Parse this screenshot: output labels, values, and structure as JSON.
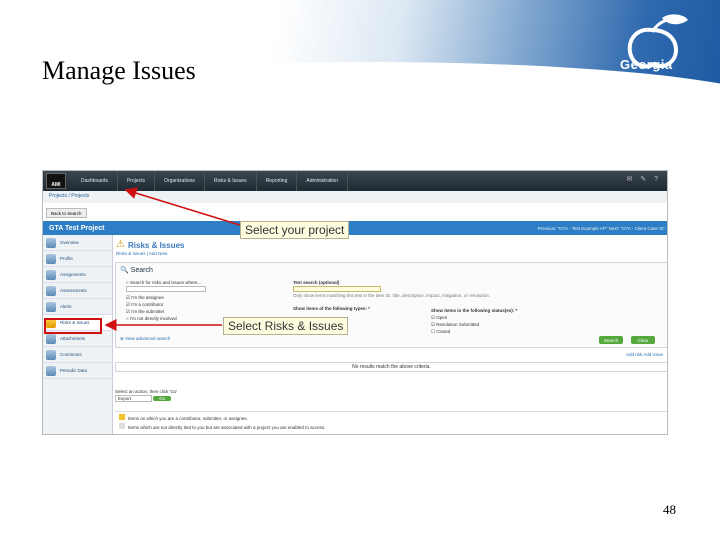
{
  "slide": {
    "title": "Manage Issues",
    "logo_text": "Georgia",
    "page_number": "48"
  },
  "app": {
    "logo": "AMI",
    "nav_tabs": [
      "Dashboards",
      "Projects",
      "Organizations",
      "Risks & Issues",
      "Reporting",
      "Administration"
    ],
    "top_icons": "✉ ✎ ?",
    "breadcrumb": "Projects / Projects",
    "back_button": "Back to Search",
    "project_title": "GTA Test Project",
    "project_links": "Previous: \"GTA - Test Example AP\"   Next: \"GTA - Client Case St\"",
    "sidebar": [
      {
        "label": "Overview"
      },
      {
        "label": "Profile"
      },
      {
        "label": "Assignments"
      },
      {
        "label": "Assessments"
      },
      {
        "label": "Alerts"
      },
      {
        "label": "Risks & Issues"
      },
      {
        "label": "Attachments"
      },
      {
        "label": "Comments"
      },
      {
        "label": "Periodic Data"
      }
    ],
    "risks_title": "Risks & Issues",
    "risks_tabs": "Risks & Issues | Add New",
    "search": {
      "title": "Search",
      "left_lines": [
        "Search for risks and issues where...",
        "I'm the assignee",
        "I'm a contributor",
        "I'm the submitter",
        "I'm not directly involved"
      ],
      "text_search_label": "Text search (optional)",
      "text_search_help": "Only show items matching this text in the item ID, title, description, impact, mitigation, or resolution.",
      "types_label": "Show items of the following types: *",
      "status_label": "Show items in the following status(es): *",
      "statuses": [
        "Open",
        "Resolution Submitted",
        "Closed"
      ],
      "advanced_link": "View advanced search",
      "btn_search": "Search",
      "btn_clear": "Clear"
    },
    "add_links": "Add risk  Add issue",
    "no_results": "No results match the above criteria.",
    "action_label": "Select an action, then click 'Go'",
    "action_value": "Export",
    "action_go": "Go",
    "legend_lines": [
      "Items on which you are a contributor, submitter, or assignee.",
      "Items which are not directly tied to you but are associated with a project you are enabled to access."
    ]
  },
  "callouts": {
    "select_project": "Select your project",
    "select_risks": "Select Risks & Issues"
  }
}
